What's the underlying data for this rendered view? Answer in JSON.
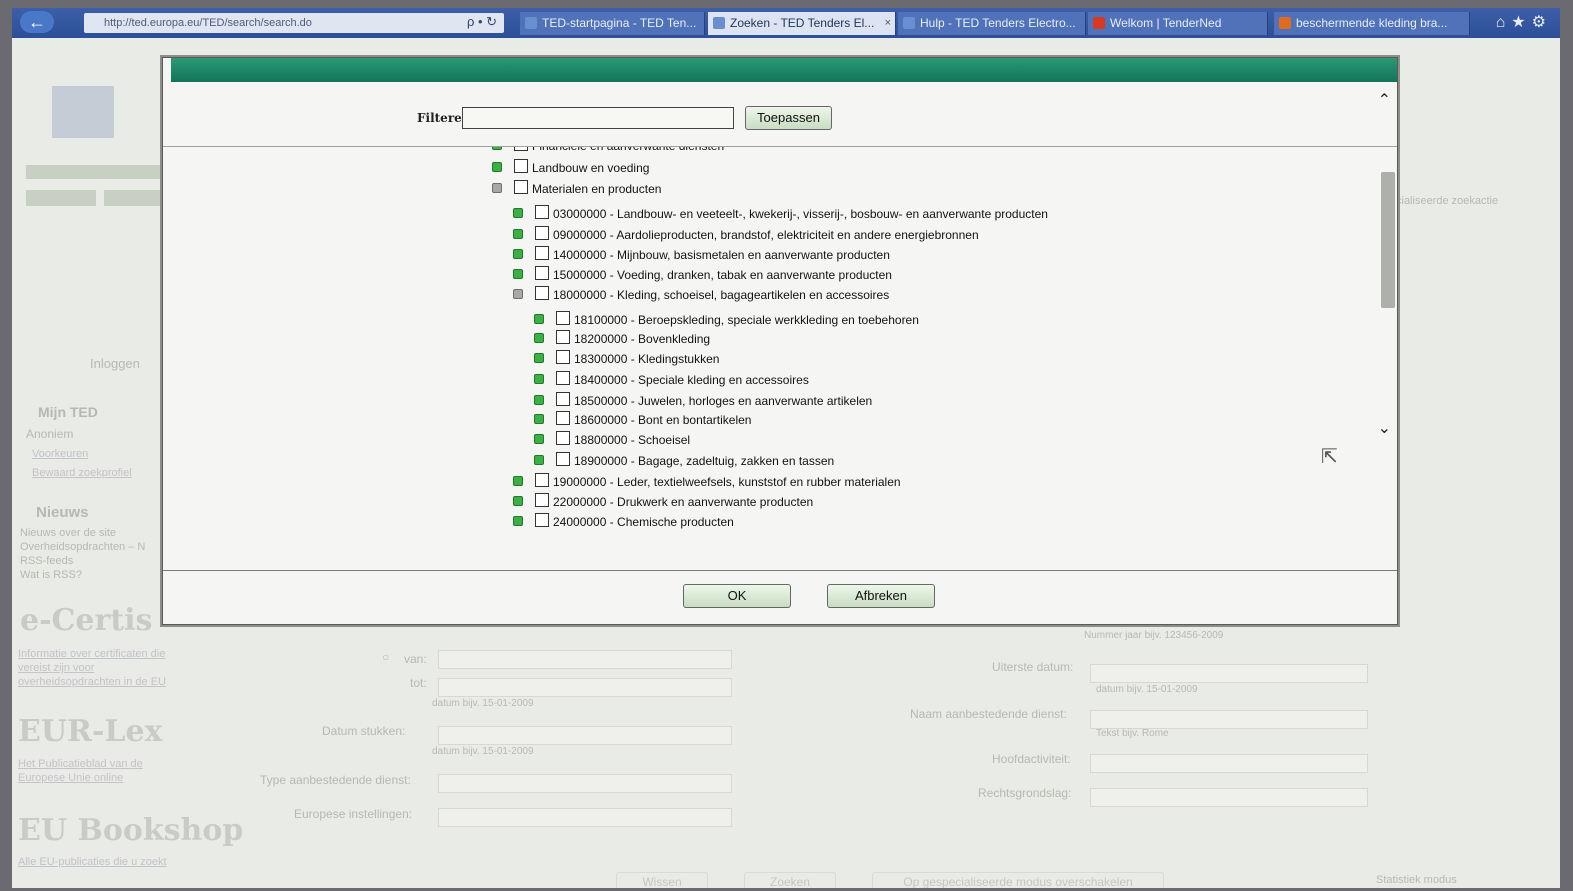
{
  "browser": {
    "address": "http://ted.europa.eu/TED/search/search.do",
    "address_controls": "ρ • ↻",
    "tabs": [
      {
        "label": "TED-startpagina - TED Ten...",
        "active": false
      },
      {
        "label": "Zoeken - TED Tenders El...",
        "active": true
      },
      {
        "label": "Hulp - TED Tenders Electro...",
        "active": false
      },
      {
        "label": "Welkom | TenderNed",
        "active": false
      },
      {
        "label": "beschermende kleding bra...",
        "active": false
      }
    ]
  },
  "background_page": {
    "sidebar_login": "Inloggen",
    "mijn_ted": "Mijn TED",
    "anoniem": "Anoniem",
    "voorkeuren": "Voorkeuren",
    "zoekprofiel": "Bewaard zoekprofiel",
    "nieuws": "Nieuws",
    "nieuws_1": "Nieuws over de site",
    "nieuws_2": "Overheidsopdrachten – N",
    "rss": "RSS-feeds",
    "rss_q": "Wat is RSS?",
    "ecertis": "e-Certis",
    "ecertis_link_1": "Informatie over certificaten die",
    "ecertis_link_2": "vereist zijn voor",
    "ecertis_link_3": "overheidsopdrachten in de EU",
    "eurlex": "EUR-Lex",
    "eurlex_link_1": "Het Publicatieblad van de",
    "eurlex_link_2": "Europese Unie online",
    "bookshop": "EU Bookshop",
    "bookshop_link": "Alle EU-publicaties die u zoekt",
    "van": "van:",
    "tot": "tot:",
    "datum_hint": "datum bijv. 15-01-2009",
    "datum_stukken": "Datum stukken:",
    "type_dienst": "Type aanbestedende dienst:",
    "europese_instellingen": "Europese instellingen:",
    "uiterste_datum": "Uiterste datum:",
    "nummer_hint": "Nummer jaar bijv. 123456-2009",
    "naam_dienst": "Naam aanbestedende dienst:",
    "naam_hint": "Tekst bijv. Rome",
    "hoofdactiviteit": "Hoofdactiviteit:",
    "rechtsgrondslag": "Rechtsgrondslag:",
    "gespecialiseerde": "cialiseerde zoekactie",
    "wissen": "Wissen",
    "zoeken": "Zoeken",
    "op_gespec": "Op gespecialiseerde modus overschakelen",
    "statistiek": "Statistiek modus"
  },
  "dialog": {
    "filter_label": "Filteren",
    "filter_value": "",
    "apply_label": "Toepassen",
    "ok_label": "OK",
    "cancel_label": "Afbreken",
    "tree": [
      {
        "label": "Financiële en aanverwante diensten",
        "level": 0,
        "expanded": false,
        "partial": true
      },
      {
        "label": "Landbouw en voeding",
        "level": 0,
        "expanded": false
      },
      {
        "label": "Materialen en producten",
        "level": 0,
        "expanded": true
      },
      {
        "label": "03000000 - Landbouw- en veeteelt-, kwekerij-, visserij-, bosbouw- en aanverwante producten",
        "level": 1,
        "expanded": false
      },
      {
        "label": "09000000 - Aardolieproducten, brandstof, elektriciteit en andere energiebronnen",
        "level": 1,
        "expanded": false
      },
      {
        "label": "14000000 - Mijnbouw, basismetalen en aanverwante producten",
        "level": 1,
        "expanded": false
      },
      {
        "label": "15000000 - Voeding, dranken, tabak en aanverwante producten",
        "level": 1,
        "expanded": false
      },
      {
        "label": "18000000 - Kleding, schoeisel, bagageartikelen en accessoires",
        "level": 1,
        "expanded": true
      },
      {
        "label": "18100000 - Beroepskleding, speciale werkkleding en toebehoren",
        "level": 2,
        "expanded": false
      },
      {
        "label": "18200000 - Bovenkleding",
        "level": 2,
        "expanded": false
      },
      {
        "label": "18300000 - Kledingstukken",
        "level": 2,
        "expanded": false
      },
      {
        "label": "18400000 - Speciale kleding en accessoires",
        "level": 2,
        "expanded": false
      },
      {
        "label": "18500000 - Juwelen, horloges en aanverwante artikelen",
        "level": 2,
        "expanded": false
      },
      {
        "label": "18600000 - Bont en bontartikelen",
        "level": 2,
        "expanded": false
      },
      {
        "label": "18800000 - Schoeisel",
        "level": 2,
        "expanded": false
      },
      {
        "label": "18900000 - Bagage, zadeltuig, zakken en tassen",
        "level": 2,
        "expanded": false
      },
      {
        "label": "19000000 - Leder, textielweefsels, kunststof en rubber materialen",
        "level": 1,
        "expanded": false
      },
      {
        "label": "22000000 - Drukwerk en aanverwante producten",
        "level": 1,
        "expanded": false
      },
      {
        "label": "24000000 - Chemische producten",
        "level": 1,
        "expanded": false
      }
    ]
  }
}
